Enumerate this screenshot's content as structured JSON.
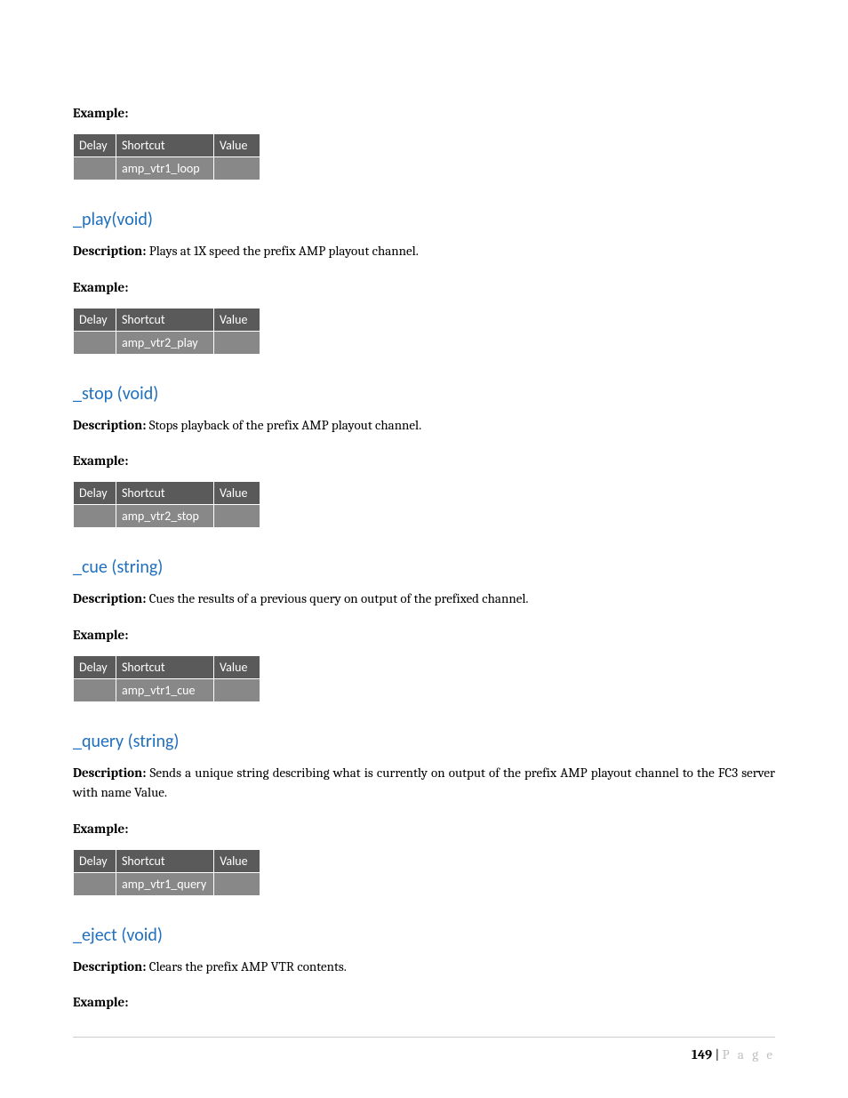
{
  "labels": {
    "example": "Example:",
    "description": "Description:"
  },
  "table_headers": {
    "delay": "Delay",
    "shortcut": "Shortcut",
    "value": "Value"
  },
  "sections": [
    {
      "example_only": true,
      "example_shortcut": "amp_vtr1_loop"
    },
    {
      "heading": "_play(void)",
      "description": "Plays at 1X speed the prefix AMP playout channel.",
      "example_shortcut": "amp_vtr2_play"
    },
    {
      "heading": "_stop (void)",
      "description": "Stops playback of the prefix AMP playout channel.",
      "example_shortcut": "amp_vtr2_stop"
    },
    {
      "heading": "_cue (string)",
      "description": "Cues the results of a previous query on output of the prefixed channel.",
      "example_shortcut": "amp_vtr1_cue"
    },
    {
      "heading": "_query (string)",
      "description": "Sends a unique string describing what is currently on output of the prefix AMP playout channel to the FC3 server with name Value.",
      "example_shortcut": "amp_vtr1_query"
    },
    {
      "heading": "_eject (void)",
      "description": "Clears the prefix AMP VTR contents.",
      "example_only_label": true
    }
  ],
  "footer": {
    "page_number": "149",
    "separator": " | ",
    "page_word": "P a g e"
  }
}
